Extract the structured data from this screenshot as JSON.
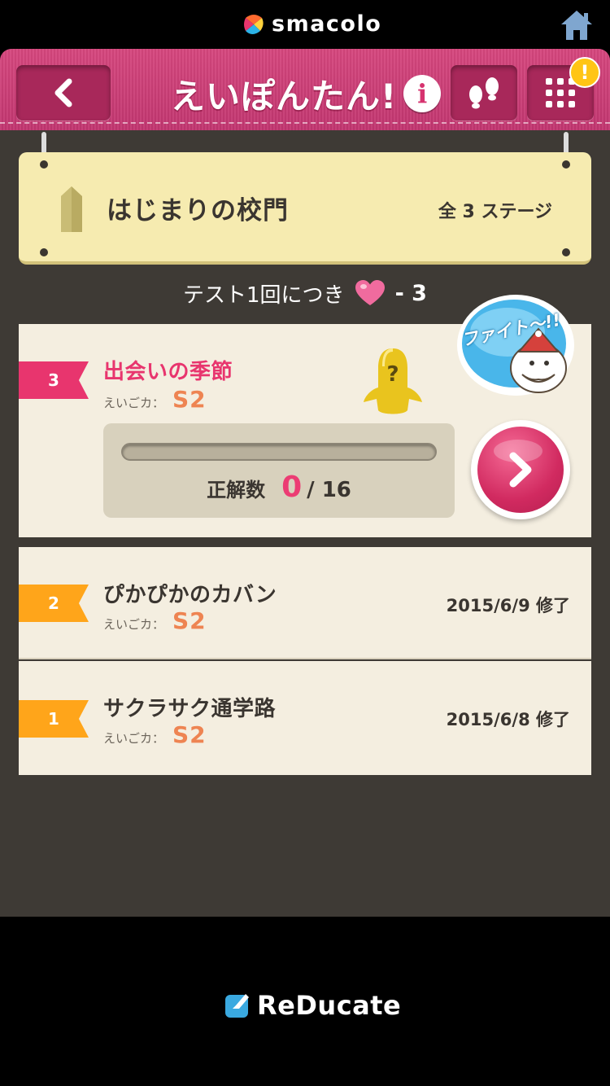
{
  "system_bar": {
    "brand": "smacolo",
    "home_icon": "home-icon"
  },
  "header": {
    "title": "えいぽんたん!",
    "info_icon_label": "i",
    "notification_badge": "!",
    "back_icon": "chevron-left-icon",
    "steps_icon": "footprints-icon",
    "menu_icon": "grid-menu-icon"
  },
  "stage": {
    "title": "はじまりの校門",
    "count_label": "全 3 ステージ"
  },
  "cost": {
    "text": "テスト1回につき",
    "value": "- 3",
    "icon": "heart-icon"
  },
  "lessons": [
    {
      "number": "3",
      "title": "出会いの季節",
      "skill_label": "えいごカ：",
      "skill_value": "S2",
      "status": "active",
      "progress": {
        "label": "正解数",
        "correct": "0",
        "total": "/ 16",
        "fraction": 0
      }
    },
    {
      "number": "2",
      "title": "ぴかぴかのカバン",
      "skill_label": "えいごカ：",
      "skill_value": "S2",
      "completed": "2015/6/9 修了"
    },
    {
      "number": "1",
      "title": "サクラサク通学路",
      "skill_label": "えいごカ：",
      "skill_value": "S2",
      "completed": "2015/6/8 修了"
    }
  ],
  "fight_bubble": {
    "text": "ファイト〜!!"
  },
  "footer": {
    "brand": "ReDucate"
  },
  "colors": {
    "header_pink": "#d6477e",
    "accent_pink": "#e8356e",
    "ribbon_orange": "#ffa51a",
    "skill_orange": "#ee8452",
    "sign_yellow": "#f6ebb0",
    "background": "#3e3a35"
  }
}
